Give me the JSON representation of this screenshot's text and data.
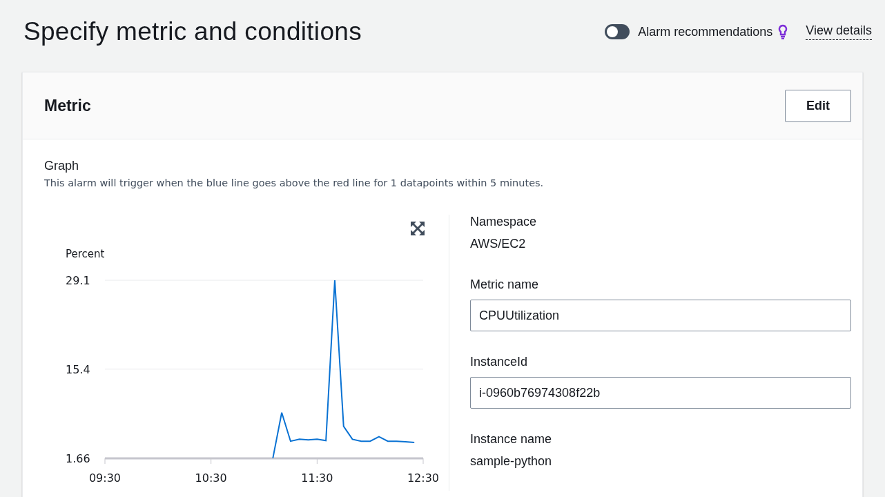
{
  "header": {
    "title": "Specify metric and conditions",
    "toggle": {
      "label": "Alarm recommendations",
      "on": false
    },
    "link": "View details"
  },
  "metric_panel": {
    "title": "Metric",
    "edit_button": "Edit",
    "graph": {
      "title": "Graph",
      "description": "This alarm will trigger when the blue line goes above the red line for 1 datapoints within 5 minutes.",
      "chart_data": {
        "type": "line",
        "ylabel": "Percent",
        "categories": [
          "09:30",
          null,
          null,
          null,
          null,
          null,
          null,
          null,
          null,
          null,
          null,
          null,
          "10:30",
          null,
          null,
          null,
          null,
          null,
          null,
          null,
          null,
          null,
          null,
          null,
          "11:30",
          null,
          null,
          null,
          null,
          null,
          null,
          null,
          null,
          null,
          null,
          null,
          "12:30"
        ],
        "series": [
          {
            "color": "#0972d3",
            "values": [
              null,
              null,
              null,
              null,
              null,
              null,
              null,
              null,
              null,
              null,
              null,
              null,
              null,
              null,
              null,
              null,
              null,
              null,
              null,
              1.7,
              8.7,
              4.3,
              4.6,
              4.5,
              4.6,
              4.4,
              29.1,
              6.6,
              4.6,
              4.3,
              4.3,
              5.0,
              4.3,
              4.3,
              4.2,
              4.1,
              null
            ]
          }
        ],
        "ylim": [
          1.66,
          29.1
        ],
        "yticks": [
          1.66,
          15.4,
          29.1
        ]
      }
    },
    "details": [
      {
        "kind": "text",
        "label": "Namespace",
        "value": "AWS/EC2"
      },
      {
        "kind": "input",
        "label": "Metric name",
        "value": "CPUUtilization"
      },
      {
        "kind": "input",
        "label": "InstanceId",
        "value": "i-0960b76974308f22b"
      },
      {
        "kind": "text",
        "label": "Instance name",
        "value": "sample-python"
      }
    ]
  }
}
